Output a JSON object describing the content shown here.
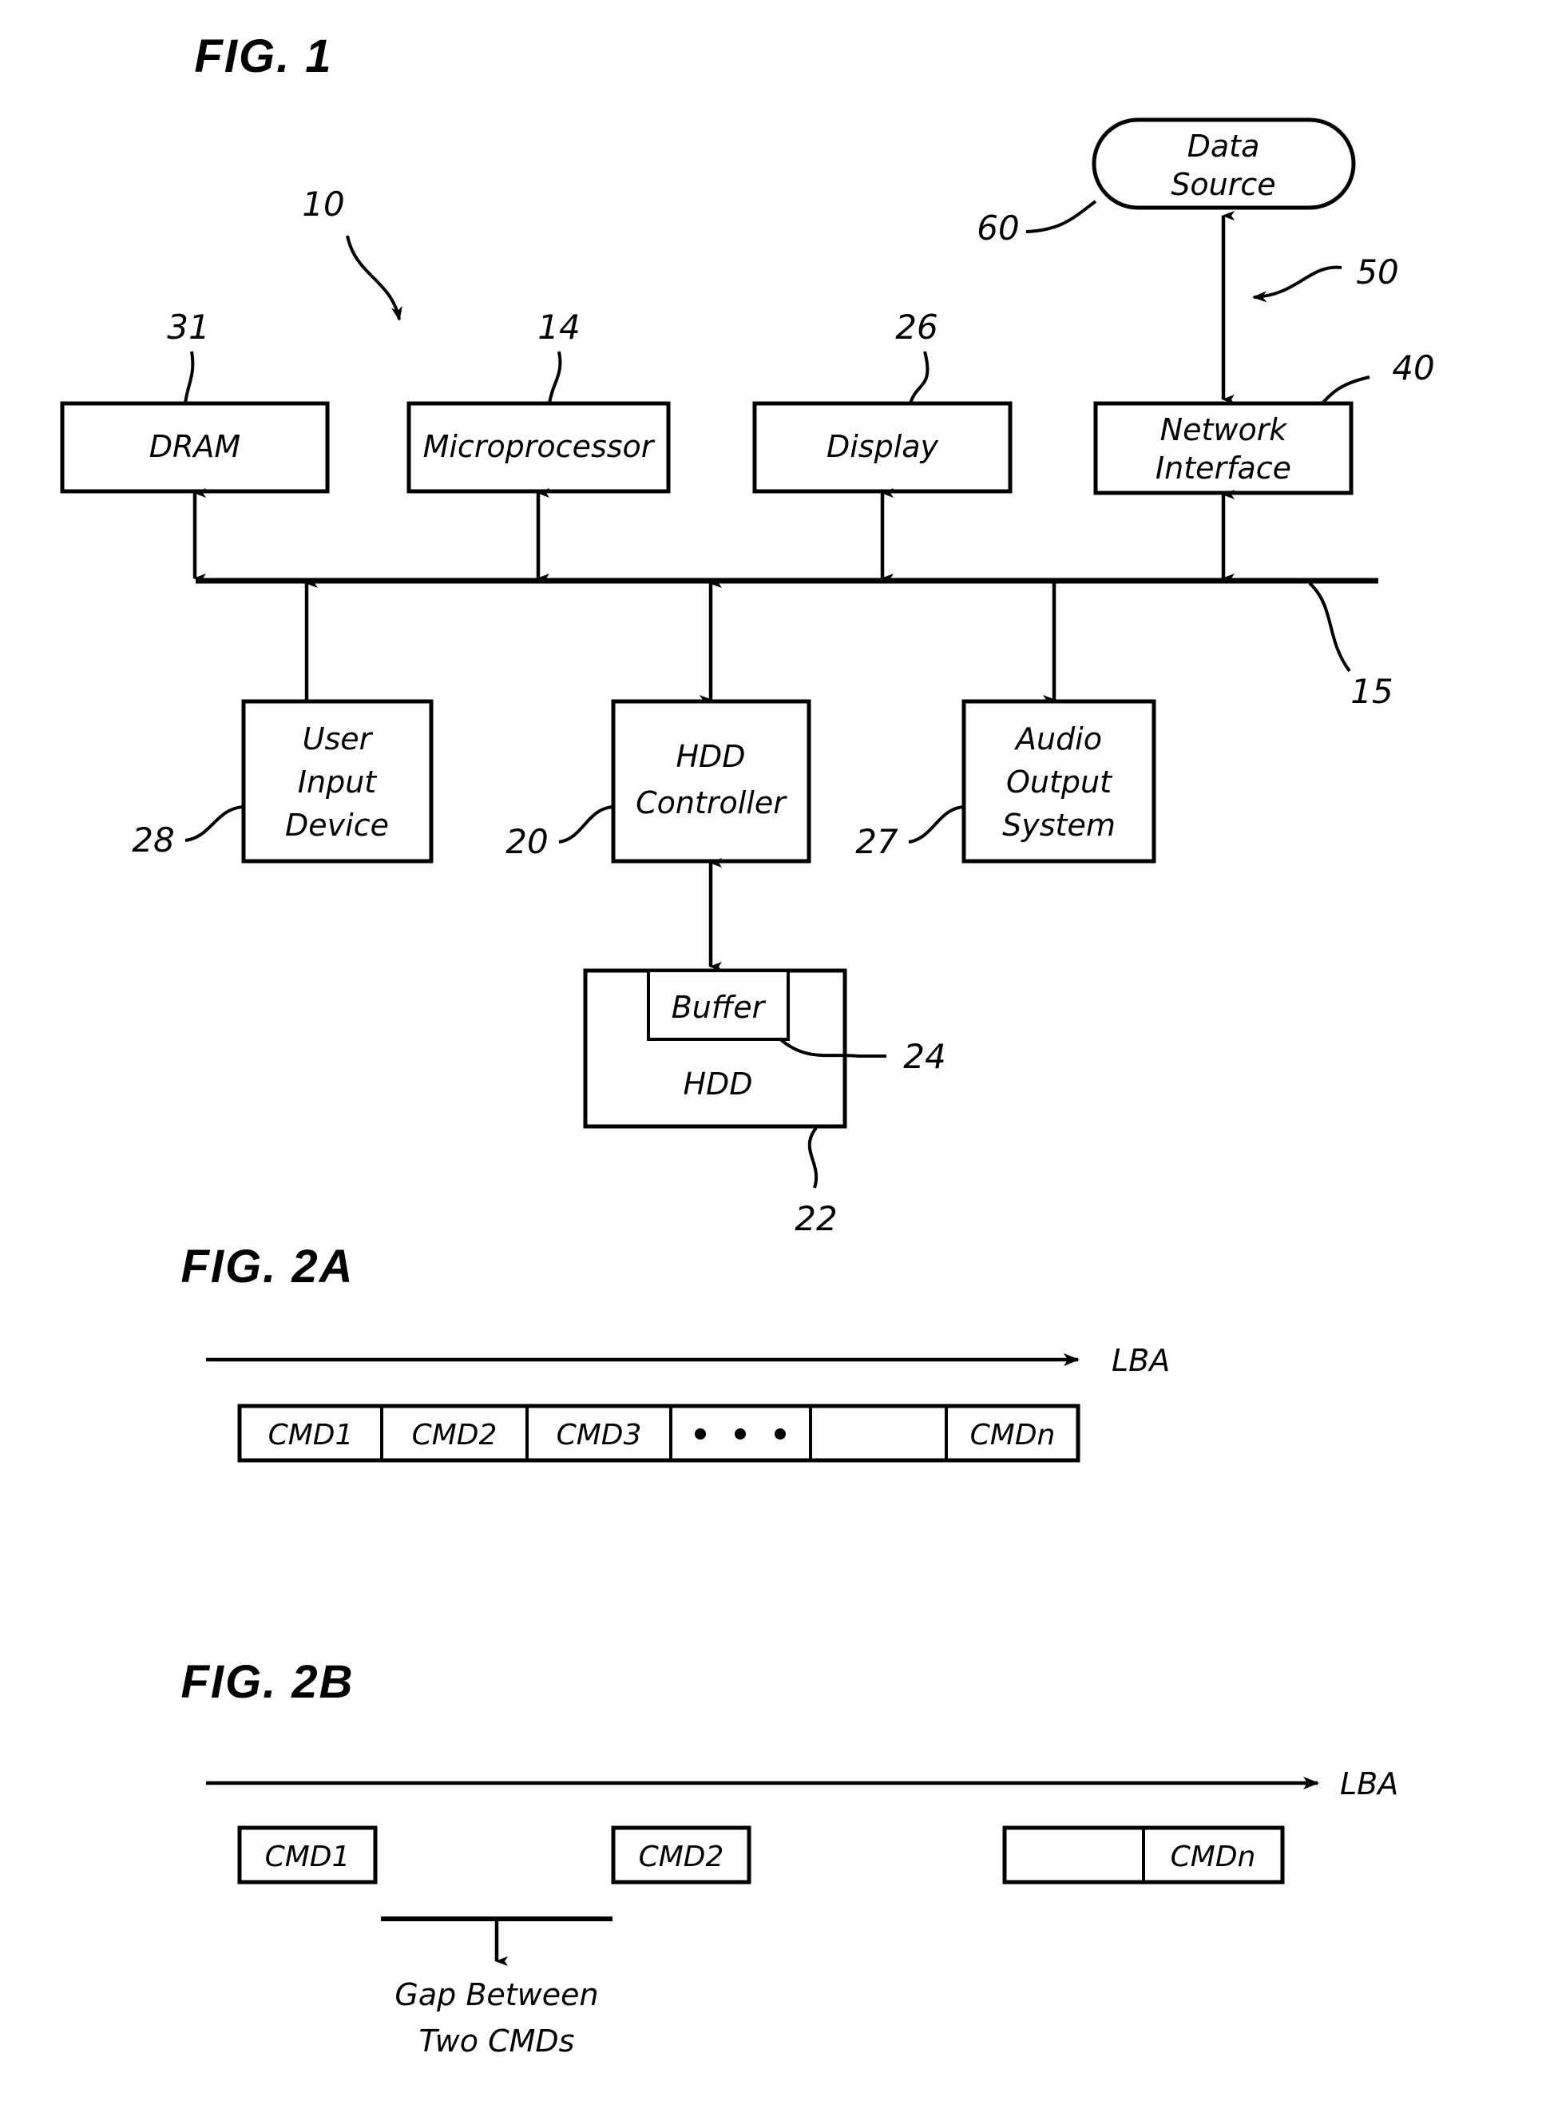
{
  "figures": [
    {
      "id": "fig1",
      "title": "FIG. 1",
      "blocks": {
        "data_source": "Data Source",
        "data_source_line1": "Data",
        "data_source_line2": "Source",
        "dram": "DRAM",
        "microprocessor": "Microprocessor",
        "display": "Display",
        "network_interface_line1": "Network",
        "network_interface_line2": "Interface",
        "user_input_line1": "User",
        "user_input_line2": "Input",
        "user_input_line3": "Device",
        "hdd_controller_line1": "HDD",
        "hdd_controller_line2": "Controller",
        "audio_output_line1": "Audio",
        "audio_output_line2": "Output",
        "audio_output_line3": "System",
        "buffer": "Buffer",
        "hdd": "HDD"
      },
      "reference_numerals": {
        "system": "10",
        "bus": "15",
        "microprocessor": "14",
        "hdd_controller": "20",
        "hdd": "22",
        "buffer": "24",
        "display": "26",
        "audio_output": "27",
        "user_input": "28",
        "dram": "31",
        "network_interface": "40",
        "network_link": "50",
        "data_source": "60"
      }
    },
    {
      "id": "fig2a",
      "title": "FIG. 2A",
      "axis_label": "LBA",
      "cells": [
        {
          "label": "CMD1",
          "type": "text"
        },
        {
          "label": "CMD2",
          "type": "text"
        },
        {
          "label": "CMD3",
          "type": "text"
        },
        {
          "label": "",
          "type": "dots"
        },
        {
          "label": "",
          "type": "empty"
        },
        {
          "label": "CMDn",
          "type": "text"
        }
      ]
    },
    {
      "id": "fig2b",
      "title": "FIG. 2B",
      "axis_label": "LBA",
      "cells": [
        {
          "label": "CMD1",
          "type": "text"
        },
        {
          "label": "CMD2",
          "type": "text"
        },
        {
          "label": "",
          "type": "empty"
        },
        {
          "label": "CMDn",
          "type": "text"
        }
      ],
      "annotation_line1": "Gap  Between",
      "annotation_line2": "Two  CMDs"
    }
  ],
  "colors": {
    "ink": "#000000",
    "paper": "#ffffff"
  }
}
